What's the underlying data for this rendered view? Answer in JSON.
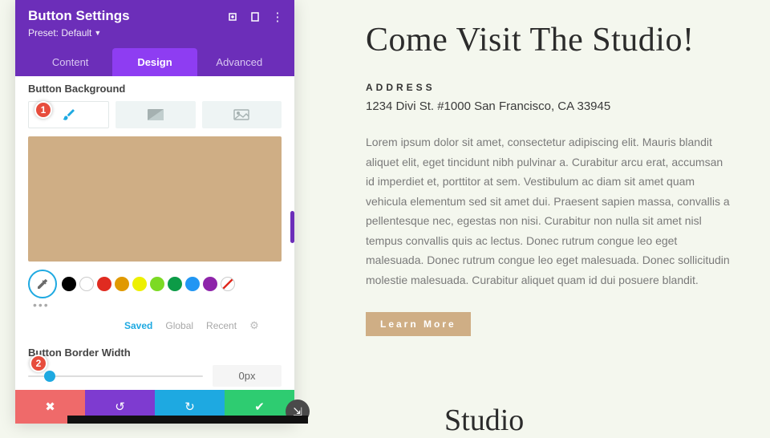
{
  "panel": {
    "title": "Button Settings",
    "preset_label": "Preset: Default",
    "tabs": {
      "content": "Content",
      "design": "Design",
      "advanced": "Advanced"
    },
    "section_bg": "Button Background",
    "preview_color": "#cfae85",
    "palette": {
      "saved": "Saved",
      "global": "Global",
      "recent": "Recent"
    },
    "section_border": "Button Border Width",
    "border_value": "0px"
  },
  "markers": {
    "one": "1",
    "two": "2"
  },
  "page": {
    "heading": "Come Visit The Studio!",
    "address_label": "ADDRESS",
    "address": "1234 Divi St. #1000 San Francisco, CA 33945",
    "lorem": "Lorem ipsum dolor sit amet, consectetur adipiscing elit. Mauris blandit aliquet elit, eget tincidunt nibh pulvinar a. Curabitur arcu erat, accumsan id imperdiet et, porttitor at sem. Vestibulum ac diam sit amet quam vehicula elementum sed sit amet dui. Praesent sapien massa, convallis a pellentesque nec, egestas non nisi. Curabitur non nulla sit amet nisl tempus convallis quis ac lectus. Donec rutrum congue leo eget malesuada. Donec rutrum congue leo eget malesuada. Donec sollicitudin molestie malesuada. Curabitur aliquet quam id dui posuere blandit.",
    "learn_more": "Learn More",
    "bottom_heading": "Studio"
  }
}
